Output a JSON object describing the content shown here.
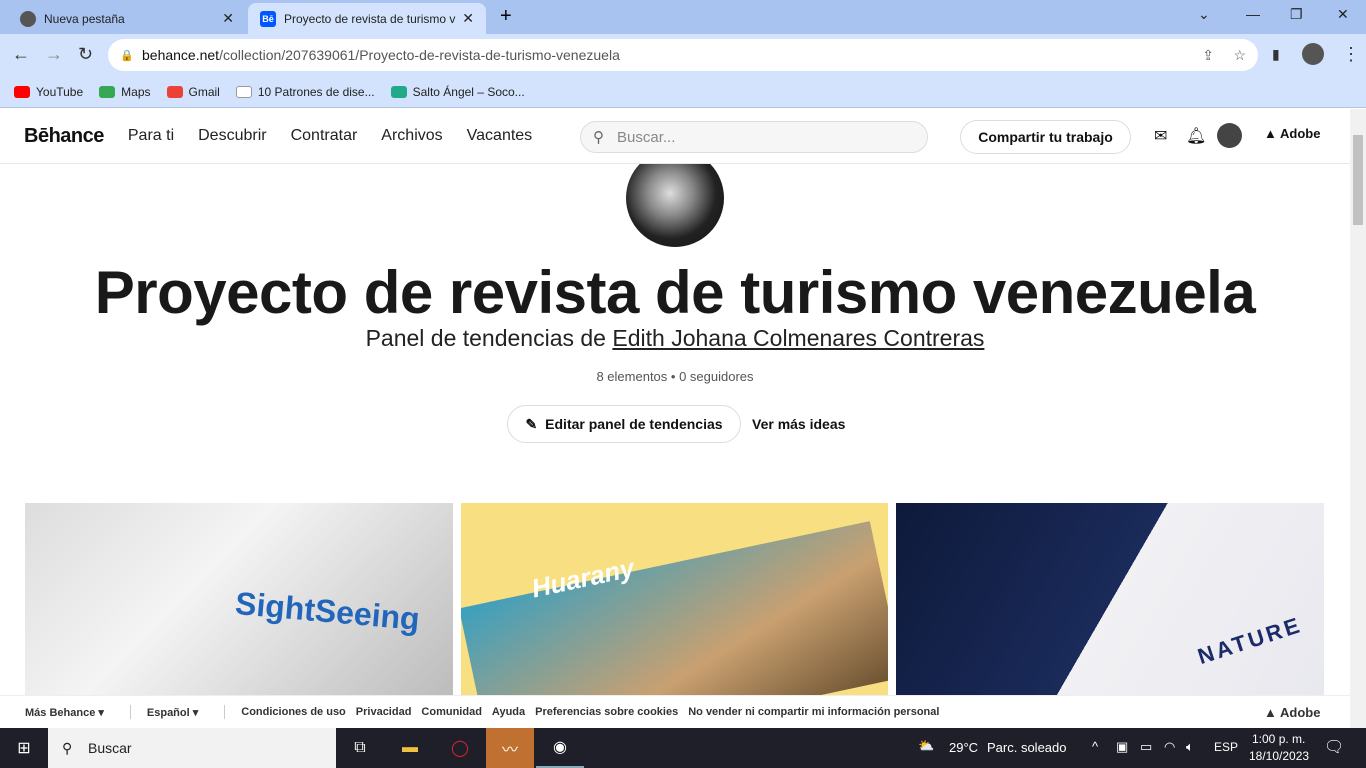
{
  "browser": {
    "tabs": [
      {
        "label": "Nueva pestaña"
      },
      {
        "label": "Proyecto de revista de turismo v"
      }
    ],
    "url_domain": "behance.net",
    "url_path": "/collection/207639061/Proyecto-de-revista-de-turismo-venezuela",
    "bookmarks": [
      "YouTube",
      "Maps",
      "Gmail",
      "10 Patrones de dise...",
      "Salto Ángel – Soco..."
    ]
  },
  "behance": {
    "logo": "Bēhance",
    "nav": [
      "Para ti",
      "Descubrir",
      "Contratar",
      "Archivos",
      "Vacantes"
    ],
    "search_placeholder": "Buscar...",
    "share_label": "Compartir tu trabajo",
    "adobe": "Adobe"
  },
  "collection": {
    "title": "Proyecto de revista de turismo venezuela",
    "subtitle_prefix": "Panel de tendencias de ",
    "owner": "Edith Johana Colmenares Contreras",
    "meta": "8 elementos • 0 seguidores",
    "edit_label": "Editar panel de tendencias",
    "more_label": "Ver más ideas",
    "cards": [
      {
        "text": "SightSeeing"
      },
      {
        "text": "Huarany"
      },
      {
        "text": "NATURE"
      }
    ]
  },
  "footer": {
    "links": [
      "Más Behance ▾",
      "Español ▾",
      "Condiciones de uso",
      "Privacidad",
      "Comunidad",
      "Ayuda",
      "Preferencias sobre cookies",
      "No vender ni compartir mi información personal"
    ],
    "adobe": "Adobe"
  },
  "taskbar": {
    "search": "Buscar",
    "weather": "29°C",
    "weather_text": "Parc. soleado",
    "lang": "ESP",
    "time": "1:00 p. m.",
    "date": "18/10/2023"
  }
}
